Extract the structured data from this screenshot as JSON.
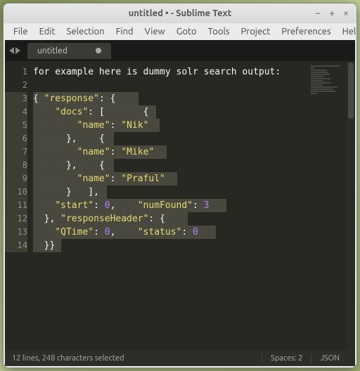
{
  "window": {
    "title": "untitled • - Sublime Text"
  },
  "menubar": [
    "File",
    "Edit",
    "Selection",
    "Find",
    "View",
    "Goto",
    "Tools",
    "Project",
    "Preferences",
    "Help"
  ],
  "tab": {
    "label": "untitled",
    "dirty": true
  },
  "gutter": [
    "1",
    "2",
    "3",
    "4",
    "5",
    "6",
    "7",
    "8",
    "9",
    "10",
    "11",
    "12",
    "13",
    "14"
  ],
  "code_lines": [
    {
      "raw": "for example here is dummy solr search output:",
      "indent": 0,
      "plain": true
    },
    {
      "raw": "",
      "indent": 0,
      "plain": true
    },
    {
      "segs": [
        {
          "t": "punc",
          "v": "{"
        },
        {
          "t": "dots",
          "v": "·"
        },
        {
          "t": "str",
          "v": "\"response\""
        },
        {
          "t": "punc",
          "v": ":"
        },
        {
          "t": "dots",
          "v": "·"
        },
        {
          "t": "punc",
          "v": "{"
        }
      ],
      "selw": 150
    },
    {
      "segs": [
        {
          "t": "dots",
          "v": "····"
        },
        {
          "t": "str",
          "v": "\"docs\""
        },
        {
          "t": "punc",
          "v": ":"
        },
        {
          "t": "dots",
          "v": "·"
        },
        {
          "t": "punc",
          "v": "["
        },
        {
          "t": "dots",
          "v": "·······"
        },
        {
          "t": "punc",
          "v": "{"
        }
      ],
      "selw": 175
    },
    {
      "segs": [
        {
          "t": "dots",
          "v": "········"
        },
        {
          "t": "str",
          "v": "\"name\""
        },
        {
          "t": "punc",
          "v": ":"
        },
        {
          "t": "dots",
          "v": "·"
        },
        {
          "t": "str",
          "v": "\"Nik\""
        }
      ],
      "selw": 180
    },
    {
      "segs": [
        {
          "t": "dots",
          "v": "······"
        },
        {
          "t": "punc",
          "v": "},"
        },
        {
          "t": "dots",
          "v": "····"
        },
        {
          "t": "punc",
          "v": "{"
        }
      ],
      "selw": 115
    },
    {
      "segs": [
        {
          "t": "dots",
          "v": "········"
        },
        {
          "t": "str",
          "v": "\"name\""
        },
        {
          "t": "punc",
          "v": ":"
        },
        {
          "t": "dots",
          "v": "·"
        },
        {
          "t": "str",
          "v": "\"Mike\""
        }
      ],
      "selw": 190
    },
    {
      "segs": [
        {
          "t": "dots",
          "v": "······"
        },
        {
          "t": "punc",
          "v": "},"
        },
        {
          "t": "dots",
          "v": "····"
        },
        {
          "t": "punc",
          "v": "{"
        }
      ],
      "selw": 115
    },
    {
      "segs": [
        {
          "t": "dots",
          "v": "········"
        },
        {
          "t": "str",
          "v": "\"name\""
        },
        {
          "t": "punc",
          "v": ":"
        },
        {
          "t": "dots",
          "v": "·"
        },
        {
          "t": "str",
          "v": "\"Praful\""
        }
      ],
      "selw": 205
    },
    {
      "segs": [
        {
          "t": "dots",
          "v": "······"
        },
        {
          "t": "punc",
          "v": "}"
        },
        {
          "t": "dots",
          "v": "···"
        },
        {
          "t": "punc",
          "v": "],"
        }
      ],
      "selw": 105
    },
    {
      "segs": [
        {
          "t": "dots",
          "v": "····"
        },
        {
          "t": "str",
          "v": "\"start\""
        },
        {
          "t": "punc",
          "v": ":"
        },
        {
          "t": "dots",
          "v": "·"
        },
        {
          "t": "num",
          "v": "0"
        },
        {
          "t": "punc",
          "v": ","
        },
        {
          "t": "dots",
          "v": "····"
        },
        {
          "t": "str",
          "v": "\"numFound\""
        },
        {
          "t": "punc",
          "v": ":"
        },
        {
          "t": "dots",
          "v": "·"
        },
        {
          "t": "num",
          "v": "3"
        }
      ],
      "selw": 275
    },
    {
      "segs": [
        {
          "t": "dots",
          "v": "··"
        },
        {
          "t": "punc",
          "v": "},"
        },
        {
          "t": "dots",
          "v": "·"
        },
        {
          "t": "str",
          "v": "\"responseHeader\""
        },
        {
          "t": "punc",
          "v": ":"
        },
        {
          "t": "dots",
          "v": "·"
        },
        {
          "t": "punc",
          "v": "{"
        }
      ],
      "selw": 220
    },
    {
      "segs": [
        {
          "t": "dots",
          "v": "····"
        },
        {
          "t": "str",
          "v": "\"QTime\""
        },
        {
          "t": "punc",
          "v": ":"
        },
        {
          "t": "dots",
          "v": "·"
        },
        {
          "t": "num",
          "v": "0"
        },
        {
          "t": "punc",
          "v": ","
        },
        {
          "t": "dots",
          "v": "····"
        },
        {
          "t": "str",
          "v": "\"status\""
        },
        {
          "t": "punc",
          "v": ":"
        },
        {
          "t": "dots",
          "v": "·"
        },
        {
          "t": "num",
          "v": "0"
        }
      ],
      "selw": 260
    },
    {
      "segs": [
        {
          "t": "dots",
          "v": "··"
        },
        {
          "t": "punc",
          "v": "}}"
        }
      ],
      "selw": 40
    }
  ],
  "status": {
    "left": "12 lines, 248 characters selected",
    "spaces": "Spaces: 2",
    "syntax": "JSON"
  }
}
